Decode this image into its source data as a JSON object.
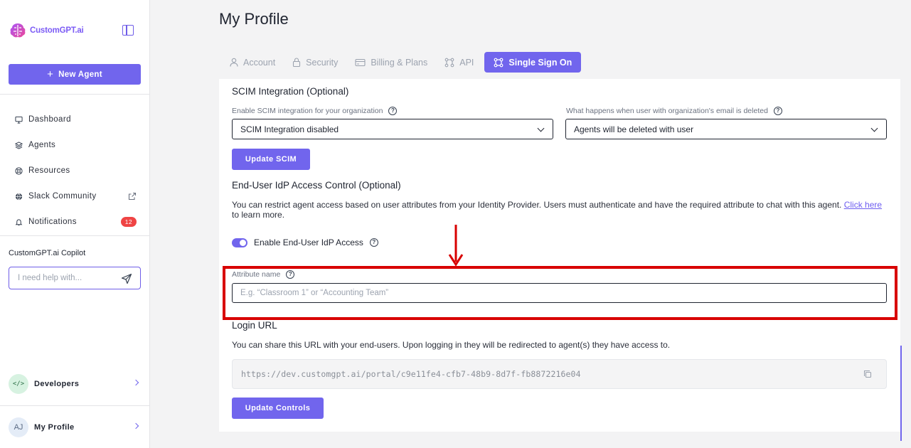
{
  "sidebar": {
    "brand": "CustomGPT.ai",
    "new_agent": "New Agent",
    "nav": [
      {
        "label": "Dashboard",
        "icon": "monitor-icon"
      },
      {
        "label": "Agents",
        "icon": "layers-icon"
      },
      {
        "label": "Resources",
        "icon": "lifebuoy-icon"
      },
      {
        "label": "Slack Community",
        "icon": "globe-icon"
      },
      {
        "label": "Notifications",
        "icon": "bell-icon",
        "badge": "12"
      }
    ],
    "copilot_label": "CustomGPT.ai Copilot",
    "copilot_placeholder": "I need help with...",
    "developers": "Developers",
    "developers_icon_text": "</>",
    "profile": "My Profile",
    "avatar_initials": "AJ"
  },
  "page": {
    "title": "My Profile",
    "tabs": [
      {
        "label": "Account",
        "active": false
      },
      {
        "label": "Security",
        "active": false
      },
      {
        "label": "Billing & Plans",
        "active": false
      },
      {
        "label": "API",
        "active": false
      },
      {
        "label": "Single Sign On",
        "active": true
      }
    ]
  },
  "scim": {
    "title": "SCIM Integration (Optional)",
    "enable_label": "Enable SCIM integration for your organization",
    "enable_value": "SCIM Integration disabled",
    "deleted_label": "What happens when user with organization's email is deleted",
    "deleted_value": "Agents will be deleted with user",
    "update_button": "Update SCIM"
  },
  "idp": {
    "title": "End-User IdP Access Control (Optional)",
    "desc_1": "You can restrict agent access based on user attributes from your Identity Provider. Users must authenticate and have the required attribute to chat with this agent. ",
    "link": "Click here ",
    "desc_2": "to learn more.",
    "toggle_label": "Enable End-User IdP Access",
    "toggle_on": true,
    "attr_label": "Attribute name",
    "attr_placeholder": "E.g. “Classroom 1” or “Accounting Team”"
  },
  "login": {
    "title": "Login URL",
    "desc": "You can share this URL with your end-users. Upon logging in they will be redirected to agent(s) they have access to.",
    "url": "https://dev.customgpt.ai/portal/c9e11fe4-cfb7-48b9-8d7f-fb8872216e04",
    "update_button": "Update Controls"
  },
  "colors": {
    "accent": "#7165ed",
    "highlight": "#d80000",
    "badge": "#ef4444"
  }
}
